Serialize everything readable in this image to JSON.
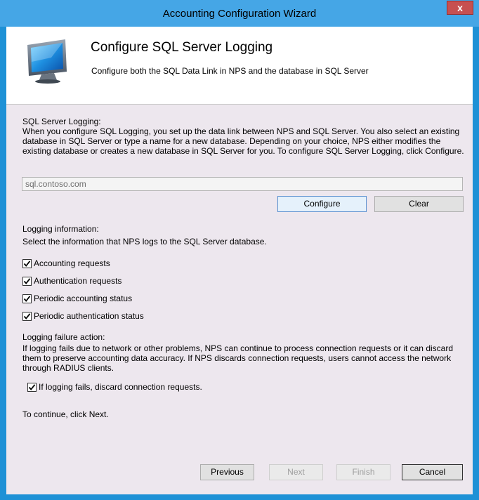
{
  "window": {
    "title": "Accounting Configuration Wizard",
    "close_label": "x"
  },
  "header": {
    "title": "Configure SQL Server Logging",
    "subtitle": "Configure both the SQL Data Link in NPS and the database in SQL Server"
  },
  "sql_logging": {
    "heading": "SQL Server Logging:",
    "description": "When you configure SQL Logging, you set up the data link between NPS and SQL Server. You also select an existing database in SQL Server or type a name for a new database. Depending on your choice, NPS either modifies the existing database or creates a new database in SQL Server for you. To configure SQL Server Logging, click Configure.",
    "server_value": "sql.contoso.com",
    "configure_label": "Configure",
    "clear_label": "Clear"
  },
  "logging_info": {
    "heading": "Logging information:",
    "description": "Select the information that NPS logs to the SQL Server database.",
    "options": [
      {
        "label": "Accounting requests",
        "checked": true
      },
      {
        "label": "Authentication requests",
        "checked": true
      },
      {
        "label": "Periodic accounting status",
        "checked": true
      },
      {
        "label": "Periodic authentication status",
        "checked": true
      }
    ]
  },
  "failure_action": {
    "heading": "Logging failure action:",
    "description": "If logging fails due to network or other problems, NPS can continue to process connection requests or it can discard them to preserve accounting data accuracy. If NPS discards connection requests, users cannot access the network through RADIUS clients.",
    "discard_label": "If logging fails, discard connection requests.",
    "discard_checked": true
  },
  "continue_text": "To continue, click Next.",
  "footer": {
    "previous_label": "Previous",
    "next_label": "Next",
    "finish_label": "Finish",
    "cancel_label": "Cancel"
  }
}
